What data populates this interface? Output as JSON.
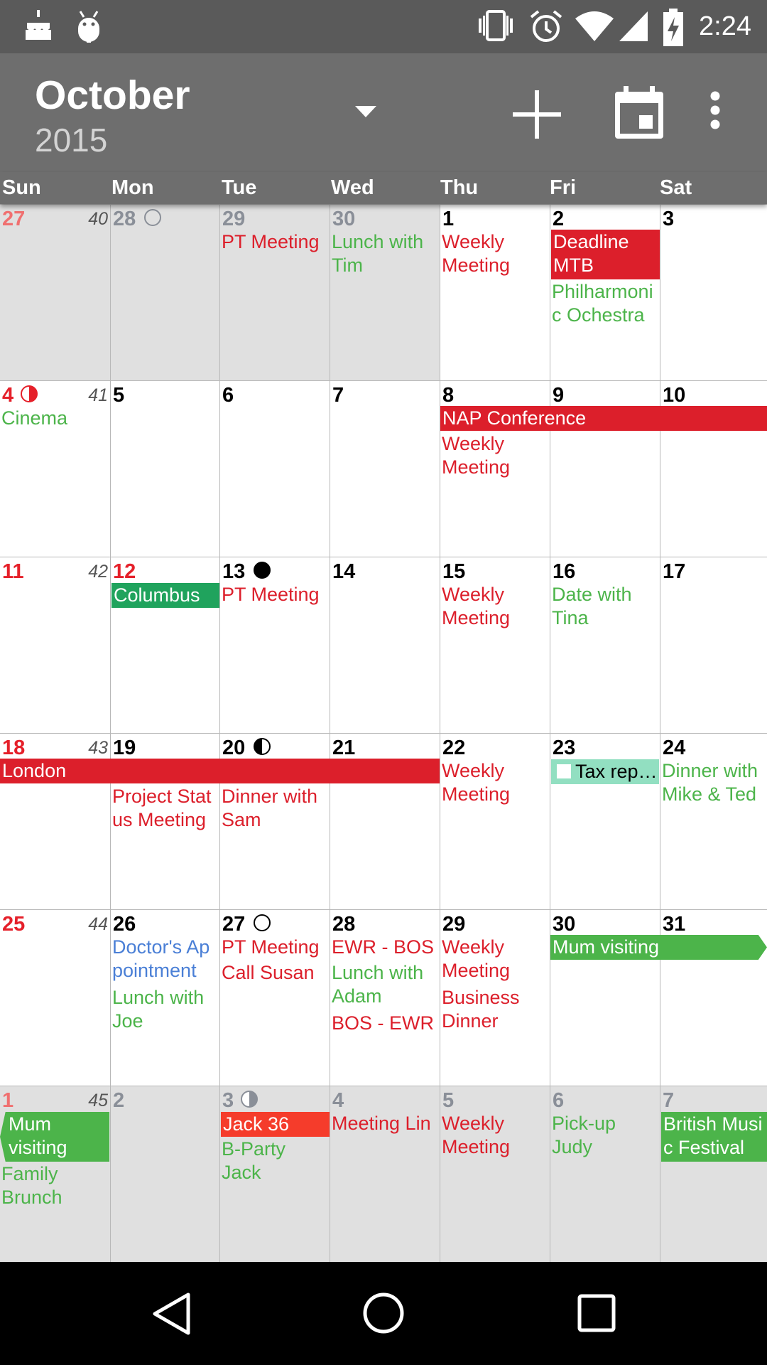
{
  "status_bar": {
    "time": "2:24"
  },
  "header": {
    "month": "October",
    "year": "2015"
  },
  "colors": {
    "red_event": "#dc1f2b",
    "green_event": "#4cb44a",
    "blue_event": "#4a7fd6",
    "green_bar": "#20a35d",
    "orange_bar": "#f53c2b",
    "teal_bar": "#92dfc1",
    "app_bar": "#6e6e6e"
  },
  "weekdays": [
    "Sun",
    "Mon",
    "Tue",
    "Wed",
    "Thu",
    "Fri",
    "Sat"
  ],
  "days": {
    "w0": [
      "27",
      "28",
      "29",
      "30",
      "1",
      "2",
      "3"
    ],
    "w1": [
      "4",
      "5",
      "6",
      "7",
      "8",
      "9",
      "10"
    ],
    "w2": [
      "11",
      "12",
      "13",
      "14",
      "15",
      "16",
      "17"
    ],
    "w3": [
      "18",
      "19",
      "20",
      "21",
      "22",
      "23",
      "24"
    ],
    "w4": [
      "25",
      "26",
      "27",
      "28",
      "29",
      "30",
      "31"
    ],
    "w5": [
      "1",
      "2",
      "3",
      "4",
      "5",
      "6",
      "7"
    ]
  },
  "week_numbers": [
    "40",
    "41",
    "42",
    "43",
    "44",
    "45"
  ],
  "events": {
    "pt_meeting": "PT Meeting",
    "lunch_tim": "Lunch with Tim",
    "weekly_meeting": "Weekly Meeting",
    "deadline_mtb": "Deadline MTB",
    "philharmonic": "Philharmonic Ochestra",
    "cinema": "Cinema",
    "nap_conference": "NAP Conference",
    "columbus": "Columbus",
    "date_tina": "Date with Tina",
    "london": "London",
    "project_status": "Project Status Meeting",
    "dinner_sam": "Dinner with Sam",
    "tax_rep": "Tax rep…",
    "dinner_mike_ted": "Dinner with Mike & Ted",
    "doctors_appointment": "Doctor's Appointment",
    "lunch_joe": "Lunch with Joe",
    "call_susan": "Call Susan",
    "ewr_bos": "EWR - BOS",
    "lunch_adam": "Lunch with Adam",
    "bos_ewr": "BOS - EWR",
    "business_dinner": "Business Dinner",
    "mum_visiting": "Mum visiting",
    "family_brunch": "Family Brunch",
    "jack_36": "Jack 36",
    "bparty_jack": "B-Party Jack",
    "meeting_lin": "Meeting Lin",
    "pickup_judy": "Pick-up Judy",
    "british_music": "British Music Festival"
  }
}
